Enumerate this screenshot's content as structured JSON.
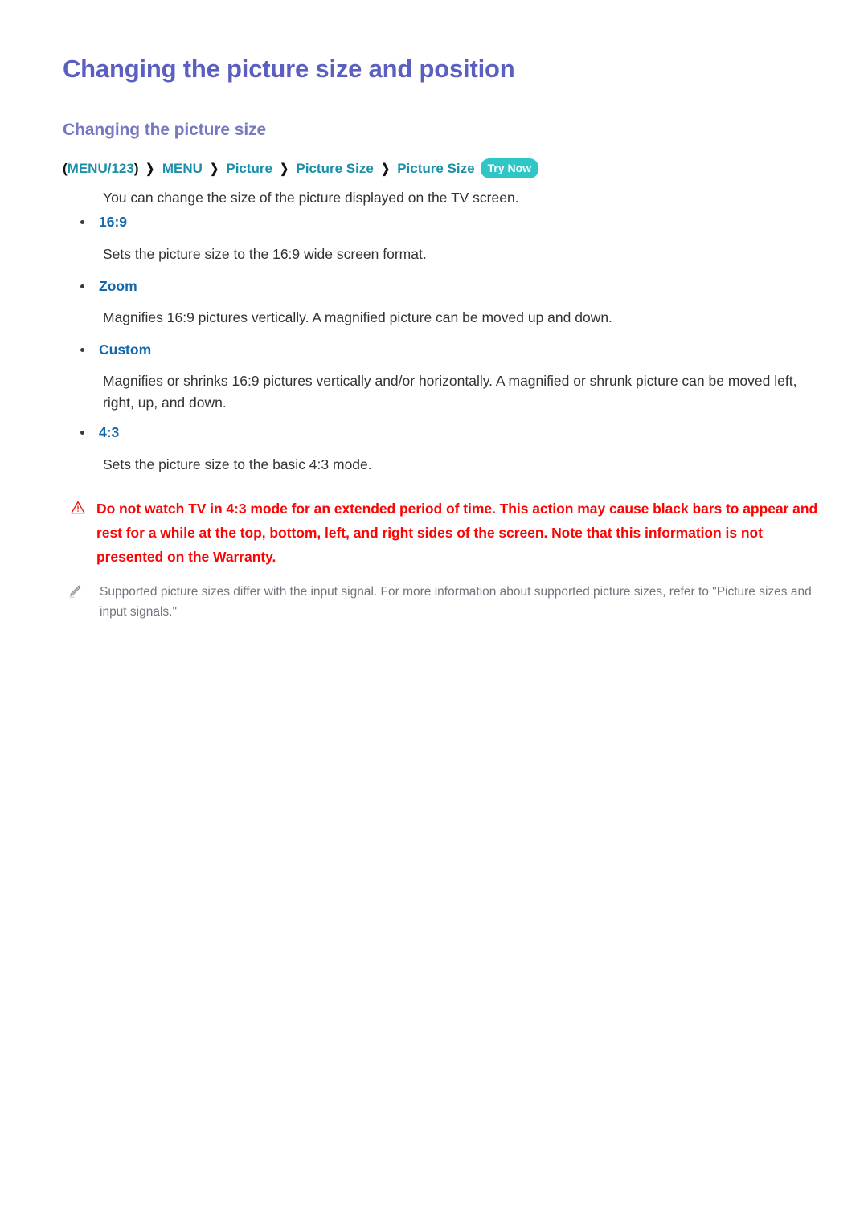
{
  "document": {
    "title": "Changing the picture size and position",
    "subtitle": "Changing the picture size"
  },
  "breadcrumb": {
    "open_paren": "(",
    "close_paren": ")",
    "separator": "❯",
    "items": [
      {
        "label": "MENU/123"
      },
      {
        "label": "MENU"
      },
      {
        "label": "Picture"
      },
      {
        "label": "Picture Size"
      },
      {
        "label": "Picture Size"
      }
    ],
    "try_now_label": "Try Now",
    "try_now_color": "#2ec6c6"
  },
  "intro": "You can change the size of the picture displayed on the TV screen.",
  "options": [
    {
      "label": "16:9",
      "description": "Sets the picture size to the 16:9 wide screen format."
    },
    {
      "label": "Zoom",
      "description": "Magnifies 16:9 pictures vertically. A magnified picture can be moved up and down."
    },
    {
      "label": "Custom",
      "description": "Magnifies or shrinks 16:9 pictures vertically and/or horizontally. A magnified or shrunk picture can be moved left, right, up, and down."
    },
    {
      "label": "4:3",
      "description": "Sets the picture size to the basic 4:3 mode."
    }
  ],
  "warning": {
    "icon": "warning-triangle-icon",
    "color": "#fc0404",
    "text": "Do not watch TV in 4:3 mode for an extended period of time. This action may cause black bars to appear and rest for a while at the top, bottom, left, and right sides of the screen. Note that this information is not presented on the Warranty."
  },
  "note": {
    "icon": "pencil-note-icon",
    "color": "#73737f",
    "text": "Supported picture sizes differ with the input signal. For more information about supported picture sizes, refer to \"Picture sizes and input signals.\""
  },
  "colors": {
    "title": "#5a5fc0",
    "subtitle": "#7679c2",
    "breadcrumb_link": "#1a8fa8",
    "option_label": "#1168ad",
    "body_text": "#333333"
  }
}
